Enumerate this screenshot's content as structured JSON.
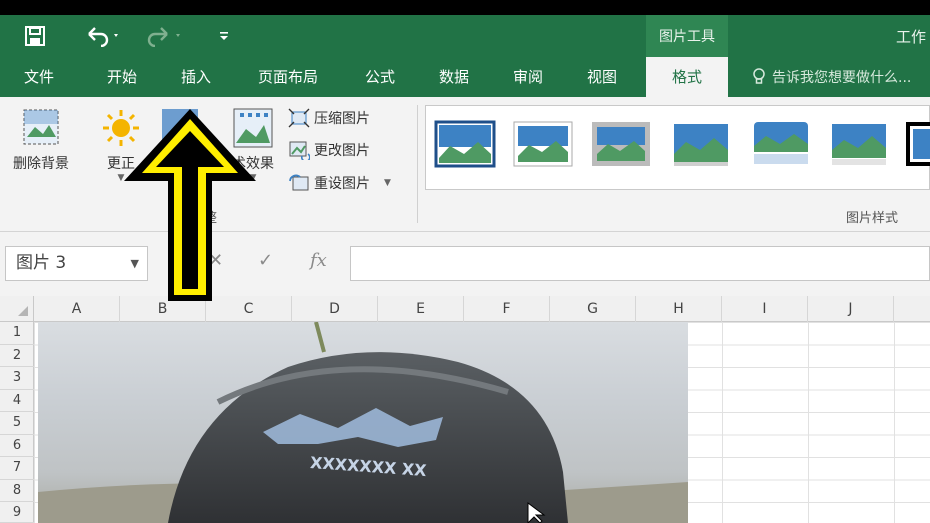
{
  "titlebar": {
    "context_title": "图片工具",
    "workbook_title": "工作"
  },
  "tabs": [
    {
      "label": "文件"
    },
    {
      "label": "开始"
    },
    {
      "label": "插入"
    },
    {
      "label": "页面布局"
    },
    {
      "label": "公式"
    },
    {
      "label": "数据"
    },
    {
      "label": "审阅"
    },
    {
      "label": "视图"
    },
    {
      "label": "格式"
    }
  ],
  "tell_me": "告诉我您想要做什么...",
  "ribbon": {
    "remove_bg": "删除背景",
    "corrections": "更正",
    "artistic_effects": "术效果",
    "compress": "压缩图片",
    "change_picture": "更改图片",
    "reset_picture": "重设图片",
    "adjust_group": "整",
    "styles_group": "图片样式"
  },
  "formula_bar": {
    "name_box": "图片 3",
    "fx": "fx",
    "formula": ""
  },
  "columns": [
    "A",
    "B",
    "C",
    "D",
    "E",
    "F",
    "G",
    "H",
    "I",
    "J"
  ],
  "rows": [
    "1",
    "2",
    "3",
    "4",
    "5",
    "6",
    "7",
    "8",
    "9"
  ],
  "colors": {
    "accent": "#217346",
    "annotation_arrow": "#ffee00"
  }
}
